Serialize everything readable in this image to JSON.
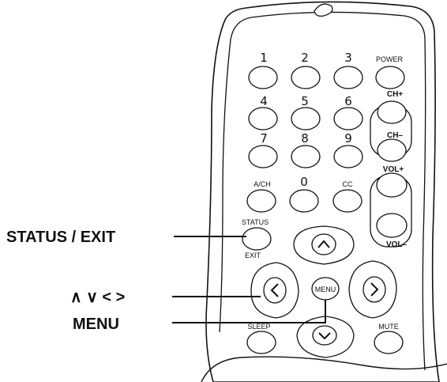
{
  "keypad": {
    "k1": "1",
    "k2": "2",
    "k3": "3",
    "power": "POWER",
    "k4": "4",
    "k5": "5",
    "k6": "6",
    "ch_plus": "CH+",
    "k7": "7",
    "k8": "8",
    "k9": "9",
    "ch_minus": "CH–",
    "ach": "A/CH",
    "k0": "0",
    "cc": "CC",
    "vol_plus": "VOL+",
    "status": "STATUS",
    "exit": "EXIT",
    "vol_minus": "VOL–",
    "menu": "MENU",
    "sleep": "SLEEP",
    "mute": "MUTE"
  },
  "callouts": {
    "status_exit": "STATUS / EXIT",
    "arrows": "∧ ∨ < >",
    "menu": "MENU"
  },
  "colors": {
    "outline": "#111111",
    "background": "#ffffff"
  }
}
